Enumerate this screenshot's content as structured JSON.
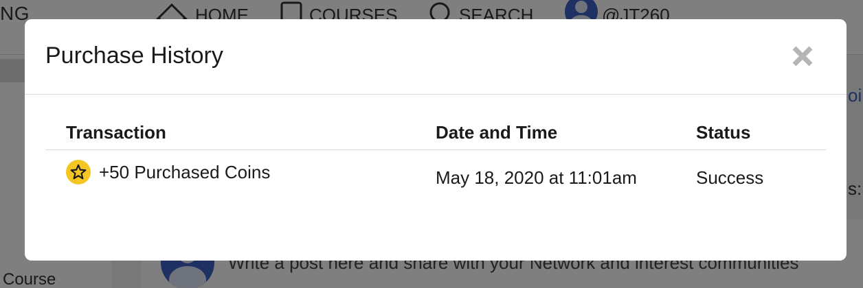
{
  "background": {
    "brand_fragment": "NG",
    "nav": {
      "home": "HOME",
      "courses": "COURSES",
      "search": "SEARCH",
      "profile": "@JT260"
    },
    "sidebar_course_label": "Course",
    "post_placeholder": "Write a post here and share with your Network and interest communities",
    "right_link_fragment": "oi",
    "right_text_fragment": "s:"
  },
  "modal": {
    "title": "Purchase History",
    "close_icon": "close-icon",
    "table": {
      "headers": [
        "Transaction",
        "Date and Time",
        "Status"
      ],
      "rows": [
        {
          "icon": "star-coin-icon",
          "transaction": "+50 Purchased Coins",
          "datetime": "May 18, 2020 at 11:01am",
          "status": "Success"
        }
      ]
    }
  },
  "colors": {
    "coin": "#f3c623",
    "accent_blue": "#3d63c4",
    "backdrop": "rgba(0,0,0,0.5)"
  }
}
